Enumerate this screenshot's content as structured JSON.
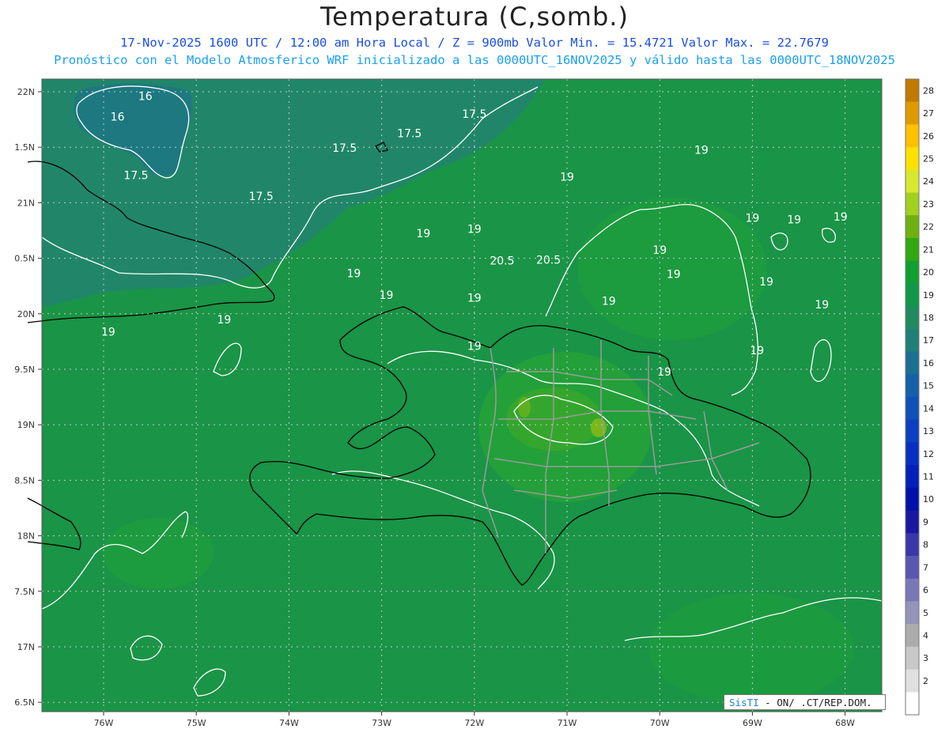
{
  "header": {
    "title": "Temperatura (C,somb.)",
    "line1": "17-Nov-2025 1600 UTC / 12:00 am Hora Local / Z = 900mb   Valor Min. = 15.4721  Valor Max. = 22.7679",
    "line2": "Pronóstico con el Modelo Atmosferico WRF inicializado a las 0000UTC_16NOV2025 y válido hasta las  0000UTC_18NOV2025"
  },
  "axes": {
    "lon_labels": [
      "76W",
      "75W",
      "74W",
      "73W",
      "72W",
      "71W",
      "70W",
      "69W",
      "68W"
    ],
    "lat_labels": [
      "22N",
      "1.5N",
      "21N",
      "0.5N",
      "20N",
      "9.5N",
      "19N",
      "8.5N",
      "18N",
      "7.5N",
      "17N",
      "6.5N"
    ]
  },
  "colorbar": {
    "labels": [
      "28",
      "27",
      "26",
      "25",
      "24",
      "23",
      "22",
      "21",
      "20",
      "19",
      "18",
      "17",
      "16",
      "15",
      "14",
      "13",
      "12",
      "11",
      "10",
      "9",
      "8",
      "7",
      "6",
      "5",
      "4",
      "3",
      "2"
    ],
    "colors": [
      "#c07a00",
      "#e09a00",
      "#ffc000",
      "#ffe000",
      "#d8e830",
      "#a0d020",
      "#70b010",
      "#30a810",
      "#10a030",
      "#109848",
      "#208a60",
      "#207f78",
      "#1a7090",
      "#1560a8",
      "#1050b8",
      "#0c40c0",
      "#0830c0",
      "#0020b8",
      "#0010a8",
      "#1818a0",
      "#3838a8",
      "#5858b0",
      "#7878b8",
      "#9494b8",
      "#acacac",
      "#c8c8c8",
      "#e0e0e0",
      "#ffffff"
    ]
  },
  "contour_labels": [
    {
      "text": "16",
      "lon": -75.55,
      "lat": 21.92
    },
    {
      "text": "16",
      "lon": -75.85,
      "lat": 21.55
    },
    {
      "text": "17.5",
      "lon": -72.0,
      "lat": 21.6
    },
    {
      "text": "17.5",
      "lon": -72.7,
      "lat": 21.25
    },
    {
      "text": "17.5",
      "lon": -73.4,
      "lat": 20.99
    },
    {
      "text": "17.5",
      "lon": -75.65,
      "lat": 20.5
    },
    {
      "text": "17.5",
      "lon": -74.3,
      "lat": 20.12
    },
    {
      "text": "19",
      "lon": -69.55,
      "lat": 20.95
    },
    {
      "text": "19",
      "lon": -71.0,
      "lat": 20.47
    },
    {
      "text": "19",
      "lon": -69.0,
      "lat": 19.73
    },
    {
      "text": "19",
      "lon": -68.55,
      "lat": 19.7
    },
    {
      "text": "19",
      "lon": -68.05,
      "lat": 19.75
    },
    {
      "text": "19",
      "lon": -72.55,
      "lat": 19.45
    },
    {
      "text": "19",
      "lon": -72.0,
      "lat": 19.53
    },
    {
      "text": "19",
      "lon": -70.0,
      "lat": 19.15
    },
    {
      "text": "20.5",
      "lon": -71.2,
      "lat": 18.97
    },
    {
      "text": "20.5",
      "lon": -71.7,
      "lat": 18.96
    },
    {
      "text": "19",
      "lon": -73.3,
      "lat": 18.73
    },
    {
      "text": "19",
      "lon": -69.85,
      "lat": 18.72
    },
    {
      "text": "19",
      "lon": -68.85,
      "lat": 18.58
    },
    {
      "text": "19",
      "lon": -72.95,
      "lat": 18.34
    },
    {
      "text": "19",
      "lon": -72.0,
      "lat": 18.29
    },
    {
      "text": "19",
      "lon": -70.55,
      "lat": 18.23
    },
    {
      "text": "19",
      "lon": -68.25,
      "lat": 18.17
    },
    {
      "text": "19",
      "lon": -74.7,
      "lat": 17.9
    },
    {
      "text": "19",
      "lon": -75.95,
      "lat": 17.68
    },
    {
      "text": "19",
      "lon": -72.0,
      "lat": 17.42
    },
    {
      "text": "19",
      "lon": -68.95,
      "lat": 17.34
    },
    {
      "text": "19",
      "lon": -69.95,
      "lat": 16.96
    }
  ],
  "stamp": {
    "brand": "SisTI",
    "rest": "- ON/ .CT/REP.DOM."
  }
}
